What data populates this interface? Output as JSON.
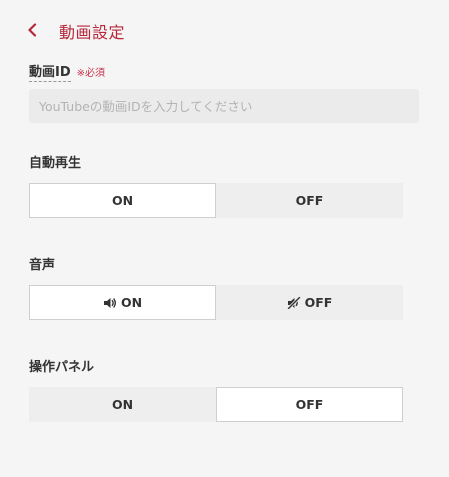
{
  "header": {
    "title": "動画設定",
    "back_icon": "chevron-left-icon"
  },
  "video_id": {
    "label": "動画ID",
    "required": "※必須",
    "value": "",
    "placeholder": "YouTubeの動画IDを入力してください"
  },
  "autoplay": {
    "label": "自動再生",
    "options": [
      "ON",
      "OFF"
    ],
    "selected": "ON"
  },
  "audio": {
    "label": "音声",
    "options": [
      "ON",
      "OFF"
    ],
    "icons": [
      "volume-on-icon",
      "volume-mute-icon"
    ],
    "selected": "ON"
  },
  "control_panel": {
    "label": "操作パネル",
    "options": [
      "ON",
      "OFF"
    ],
    "selected": "OFF"
  },
  "colors": {
    "accent": "#b5283a",
    "required": "#c8334a",
    "background": "#f6f5f5",
    "option_inactive": "#eeeeee",
    "option_active": "#ffffff"
  }
}
